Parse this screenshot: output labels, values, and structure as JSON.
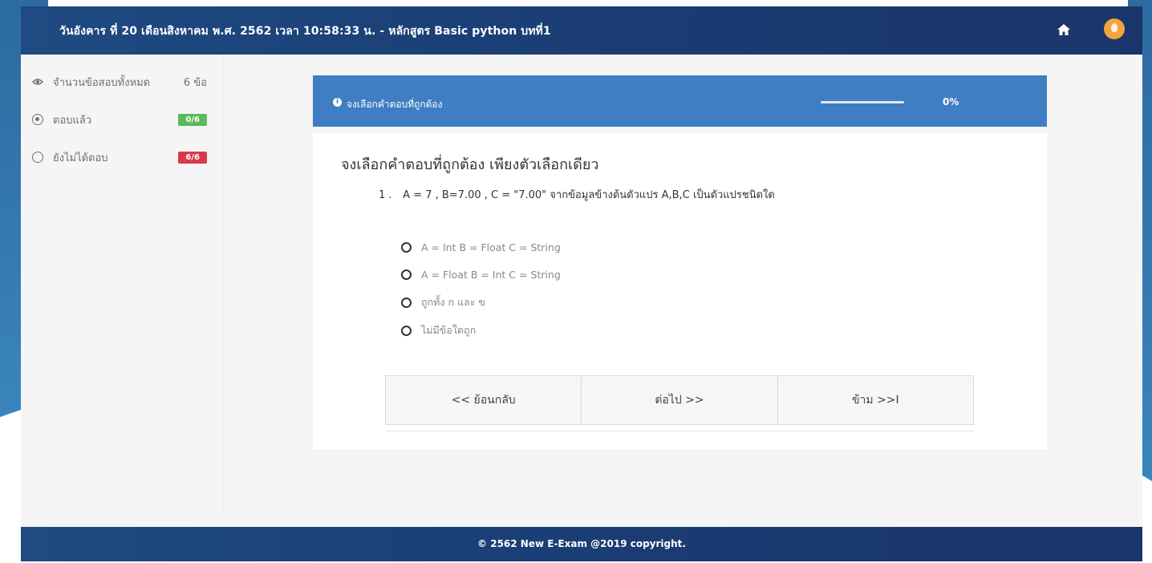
{
  "header": {
    "title": "วันอังคาร ที่ 20 เดือนสิงหาคม พ.ศ. 2562 เวลา 10:58:33 น. - หลักสูตร Basic python บทที่1",
    "home_icon": "home-icon",
    "hint_icon": "lightbulb-icon"
  },
  "sidebar": {
    "items": [
      {
        "label": "จำนวนข้อสอบทั้งหมด",
        "value": "6 ข้อ",
        "icon": "eye-icon"
      },
      {
        "label": "ตอบแล้ว",
        "value": "0/6",
        "icon": "radio-checked-icon",
        "badge_color": "#5cb85c"
      },
      {
        "label": "ยังไม่ได้ตอบ",
        "value": "6/6",
        "icon": "radio-empty-icon",
        "badge_color": "#d9394a"
      }
    ]
  },
  "panel": {
    "header_label": "จงเลือกคำตอบที่ถูกต้อง",
    "progress_value": 0,
    "progress_text": "0%",
    "question_title": "จงเลือกคำตอบที่ถูกต้อง เพียงตัวเลือกเดียว",
    "question_number": "1 .",
    "question_text": "A = 7 , B=7.00 , C = \"7.00\" จากข้อมูลข้างต้นตัวแปร A,B,C เป็นตัวแปรชนิดใด",
    "options": [
      "A = Int B = Float C = String",
      "A = Float B = Int C = String",
      "ถูกทั้ง ก และ ข",
      "ไม่มีข้อใดถูก"
    ]
  },
  "nav": {
    "back_label": "<< ย้อนกลับ",
    "next_label": "ต่อไป >>",
    "skip_label": "ข้าม >>I"
  },
  "footer": {
    "copyright": "© 2562 New E-Exam @2019 copyright."
  },
  "colors": {
    "header_bg": "#1f4a82",
    "panel_header_bg": "#3f7ec2",
    "answered_badge": "#5cb85c",
    "unanswered_badge": "#d9394a"
  }
}
